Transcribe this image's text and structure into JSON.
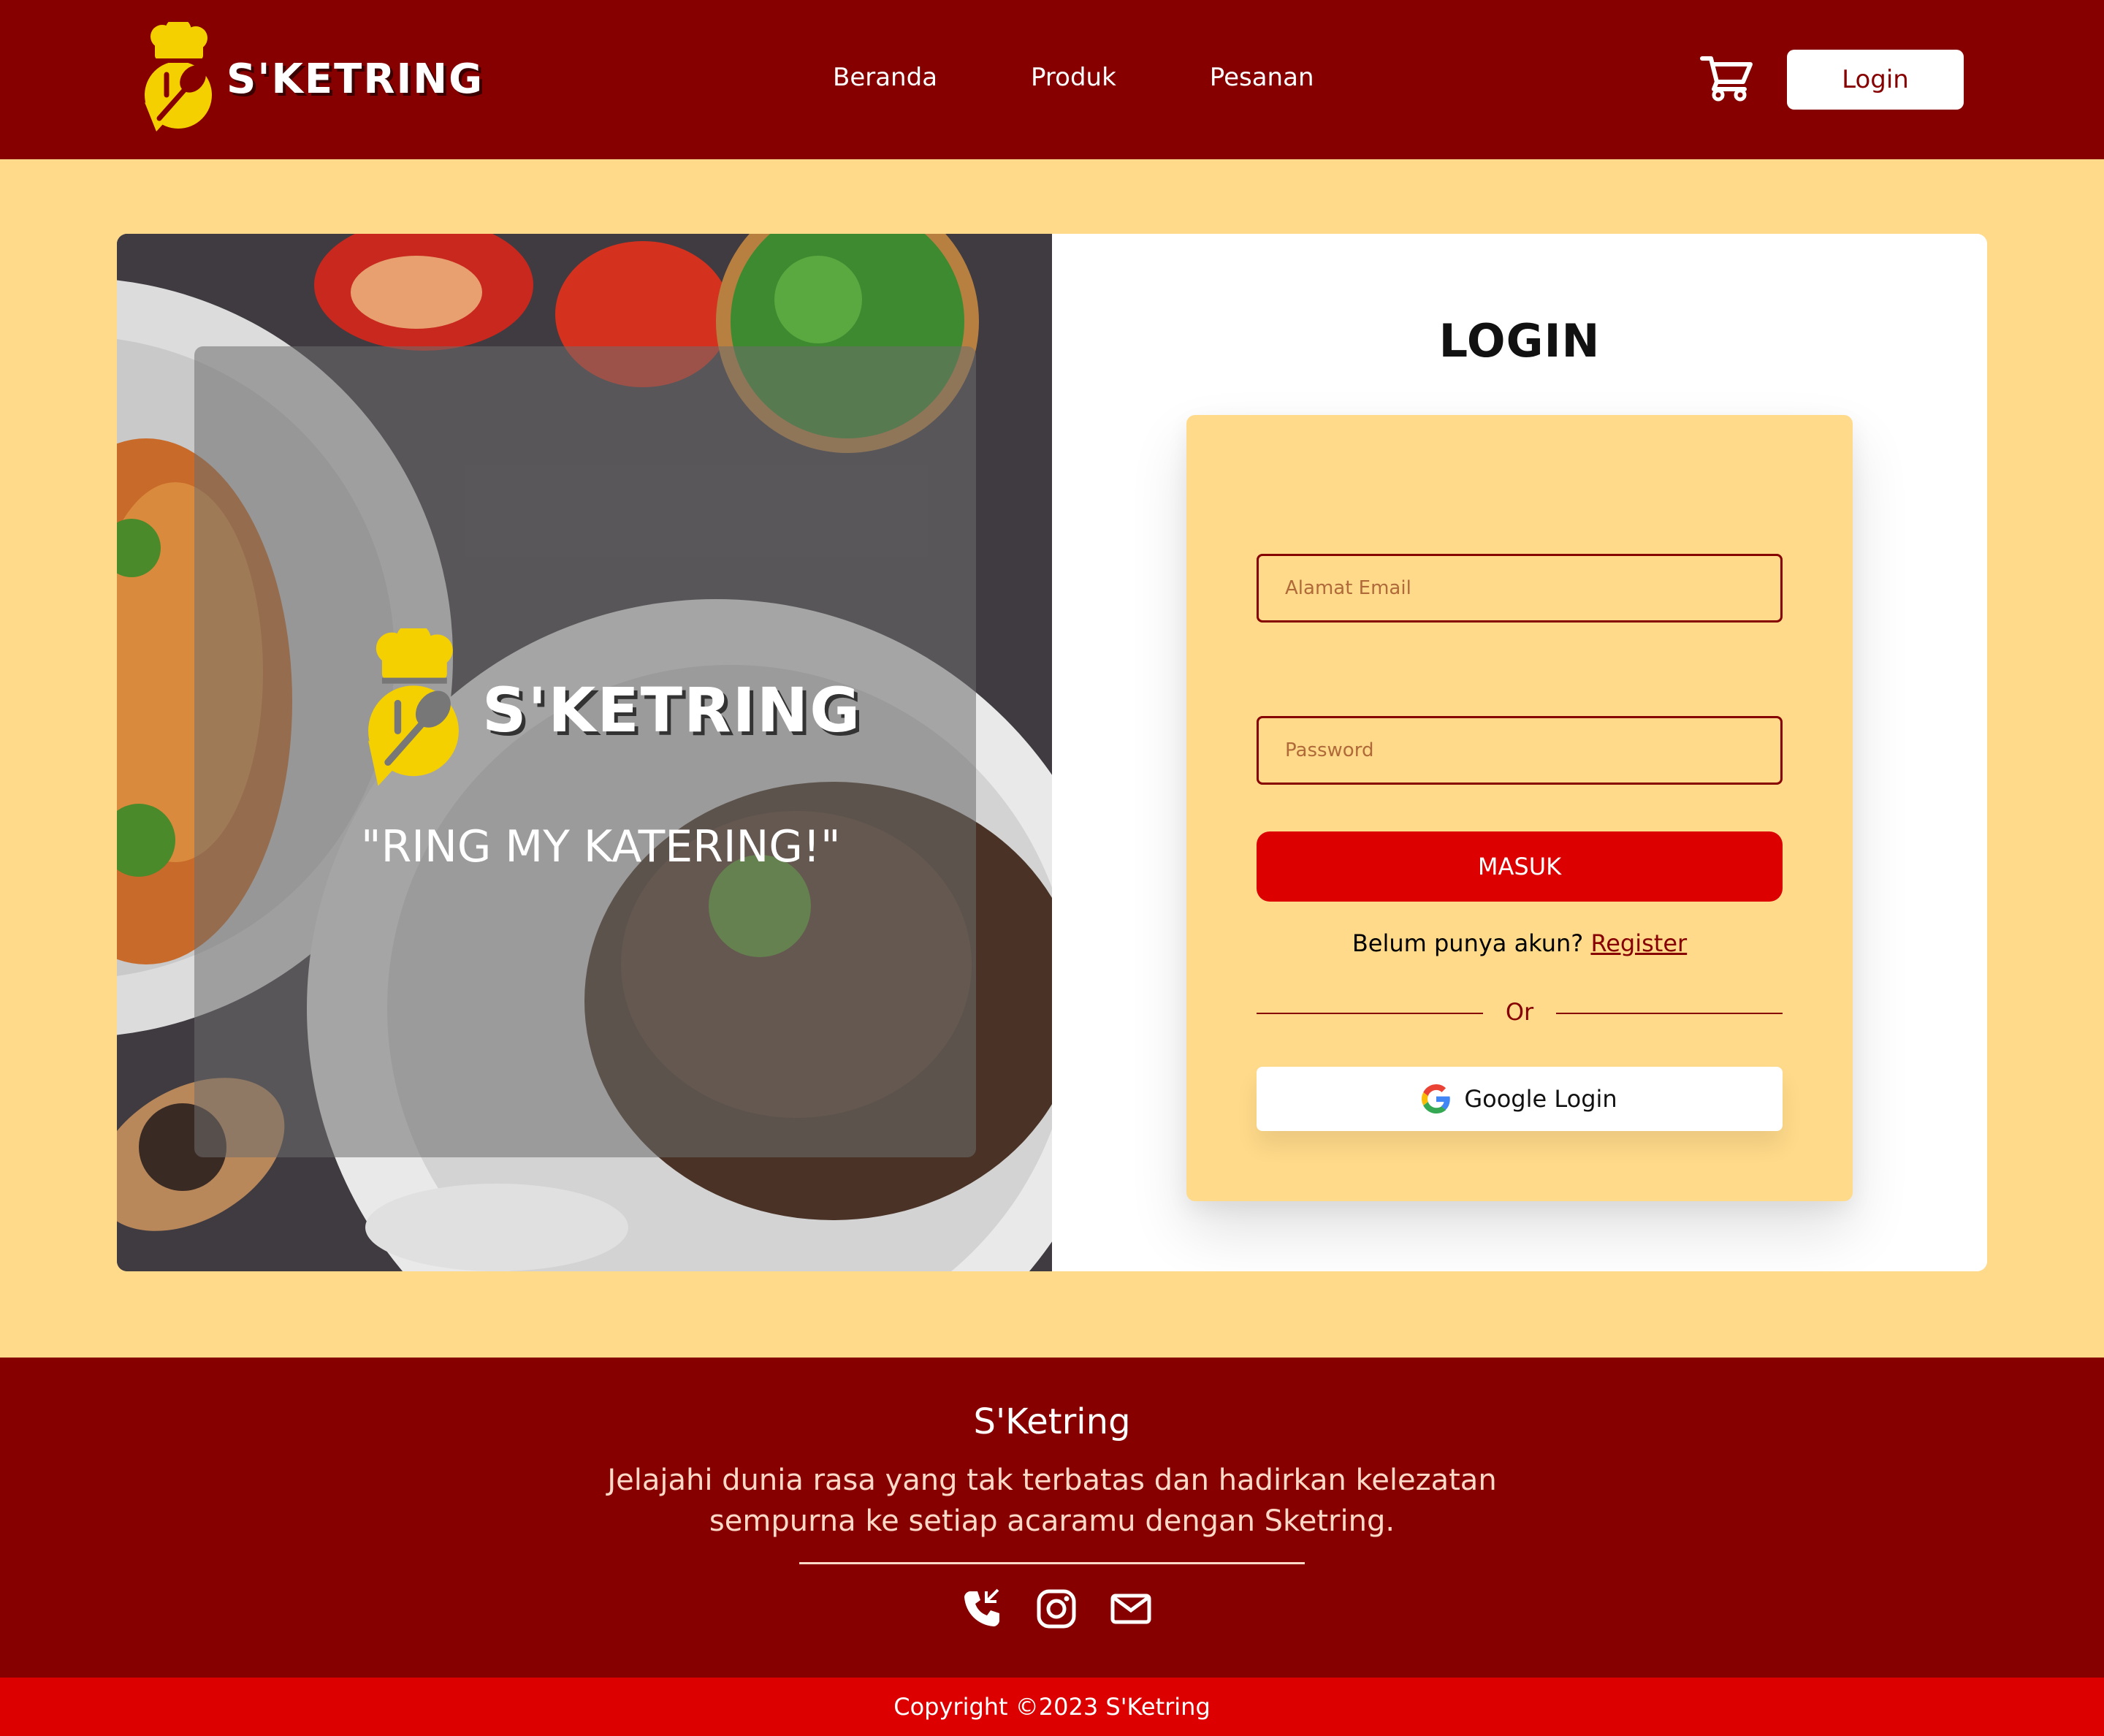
{
  "header": {
    "brand": "S'KETRING",
    "nav": [
      "Beranda",
      "Produk",
      "Pesanan"
    ],
    "cart_icon": "cart-icon",
    "login_label": "Login"
  },
  "hero": {
    "brand": "S'KETRING",
    "slogan": "\"RING MY KATERING!\""
  },
  "login_form": {
    "title": "LOGIN",
    "email_placeholder": "Alamat Email",
    "password_placeholder": "Password",
    "submit_label": "MASUK",
    "register_prompt": "Belum punya akun?",
    "register_link": "Register",
    "or_label": "Or",
    "google_label": "Google Login"
  },
  "footer": {
    "title": "S'Ketring",
    "description": "Jelajahi dunia rasa yang tak terbatas dan hadirkan kelezatan sempurna ke setiap acaramu dengan Sketring.",
    "social_icons": [
      "phone-icon",
      "instagram-icon",
      "mail-icon"
    ],
    "copyright": "Copyright ©2023 S'Ketring"
  },
  "colors": {
    "primary": "#860000",
    "accent": "#dd0000",
    "background": "#ffda8a",
    "logo_yellow": "#f5d000"
  }
}
